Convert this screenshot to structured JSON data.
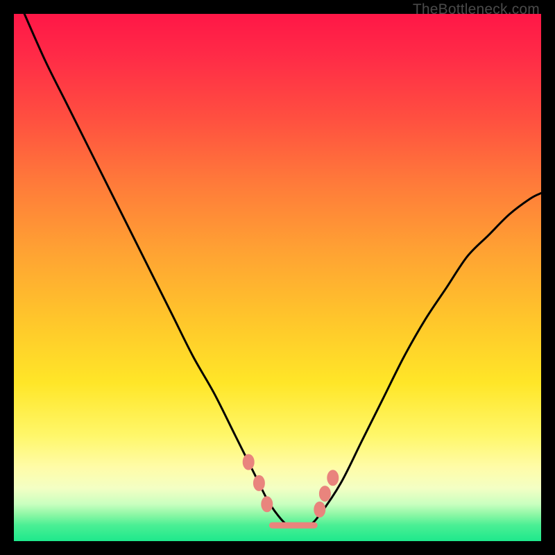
{
  "watermark": "TheBottleneck.com",
  "colors": {
    "frame": "#000000",
    "curve": "#000000",
    "marker": "#e9847d",
    "gradient_top": "#ff1747",
    "gradient_bottom": "#1ee88c"
  },
  "chart_data": {
    "type": "line",
    "title": "",
    "xlabel": "",
    "ylabel": "",
    "xlim": [
      0,
      100
    ],
    "ylim": [
      0,
      100
    ],
    "grid": false,
    "legend": false,
    "series": [
      {
        "name": "bottleneck-curve",
        "x": [
          2,
          6,
          10,
          14,
          18,
          22,
          26,
          30,
          34,
          38,
          42,
          46,
          48,
          50,
          52,
          54,
          56,
          58,
          62,
          66,
          70,
          74,
          78,
          82,
          86,
          90,
          94,
          98,
          100
        ],
        "y": [
          100,
          91,
          83,
          75,
          67,
          59,
          51,
          43,
          35,
          28,
          20,
          12,
          8,
          5,
          3,
          3,
          3,
          5,
          11,
          19,
          27,
          35,
          42,
          48,
          54,
          58,
          62,
          65,
          66
        ]
      }
    ],
    "markers": [
      {
        "x": 44.5,
        "y": 15
      },
      {
        "x": 46.5,
        "y": 11
      },
      {
        "x": 48.0,
        "y": 7
      },
      {
        "x": 58.0,
        "y": 6
      },
      {
        "x": 59.0,
        "y": 9
      },
      {
        "x": 60.5,
        "y": 12
      }
    ],
    "trough_segment": {
      "x_start": 49,
      "x_end": 57,
      "y": 3
    }
  }
}
